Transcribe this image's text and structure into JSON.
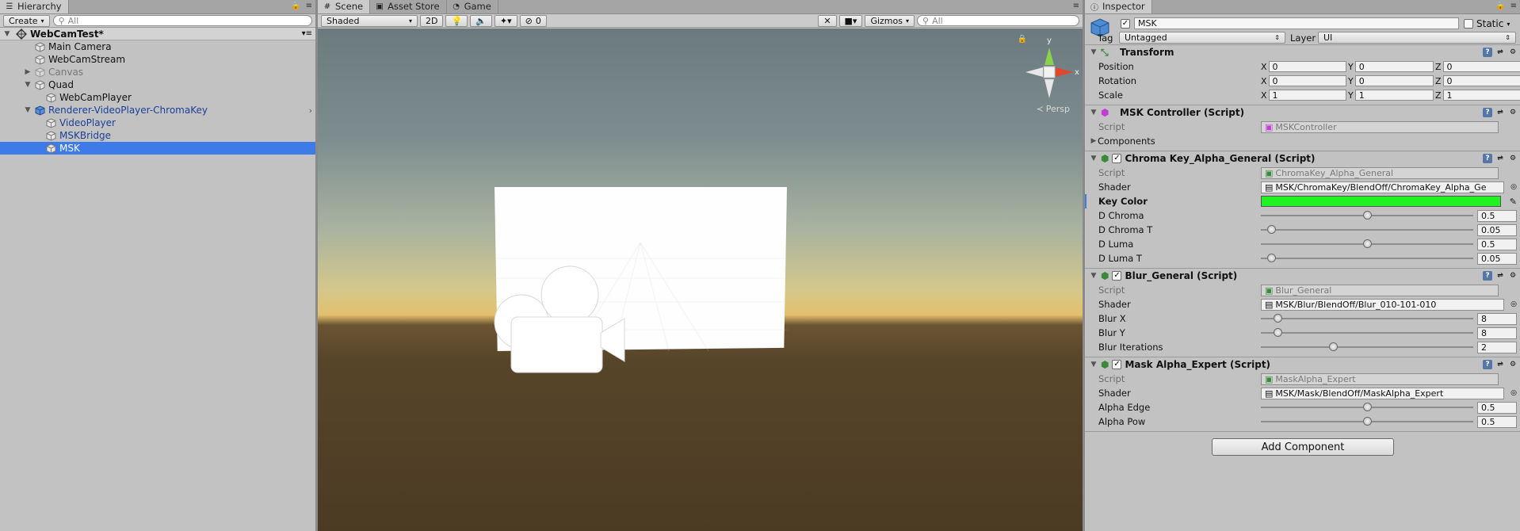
{
  "hierarchy": {
    "tab_label": "Hierarchy",
    "create_label": "Create",
    "search_placeholder": "All",
    "scene_name": "WebCamTest*",
    "items": [
      {
        "label": "Main Camera"
      },
      {
        "label": "WebCamStream"
      },
      {
        "label": "Canvas"
      },
      {
        "label": "Quad"
      },
      {
        "label": "WebCamPlayer"
      },
      {
        "label": "Renderer-VideoPlayer-ChromaKey"
      },
      {
        "label": "VideoPlayer"
      },
      {
        "label": "MSKBridge"
      },
      {
        "label": "MSK"
      }
    ]
  },
  "scene": {
    "tabs": [
      {
        "label": "Scene"
      },
      {
        "label": "Asset Store"
      },
      {
        "label": "Game"
      }
    ],
    "shading_mode": "Shaded",
    "mode_2d": "2D",
    "hidden_count": "0",
    "gizmos_label": "Gizmos",
    "search_placeholder": "All",
    "persp_label": "Persp",
    "gizmo_axes": {
      "x": "x",
      "y": "y"
    }
  },
  "inspector": {
    "tab_label": "Inspector",
    "object_name": "MSK",
    "static_label": "Static",
    "tag_label": "Tag",
    "tag_value": "Untagged",
    "layer_label": "Layer",
    "layer_value": "UI",
    "transform": {
      "title": "Transform",
      "rows": [
        {
          "label": "Position",
          "x": "0",
          "y": "0",
          "z": "0"
        },
        {
          "label": "Rotation",
          "x": "0",
          "y": "0",
          "z": "0"
        },
        {
          "label": "Scale",
          "x": "1",
          "y": "1",
          "z": "1"
        }
      ]
    },
    "msk_controller": {
      "title": "MSK Controller (Script)",
      "script_label": "Script",
      "script_value": "MSKController",
      "components_label": "Components"
    },
    "chroma_key": {
      "title": "Chroma Key_Alpha_General (Script)",
      "script_label": "Script",
      "script_value": "ChromaKey_Alpha_General",
      "shader_label": "Shader",
      "shader_value": "MSK/ChromaKey/BlendOff/ChromaKey_Alpha_Ge",
      "key_color_label": "Key Color",
      "key_color": "#22f222",
      "sliders": [
        {
          "label": "D Chroma",
          "value": "0.5",
          "fraction": 0.5
        },
        {
          "label": "D Chroma T",
          "value": "0.05",
          "fraction": 0.05
        },
        {
          "label": "D Luma",
          "value": "0.5",
          "fraction": 0.5
        },
        {
          "label": "D Luma T",
          "value": "0.05",
          "fraction": 0.05
        }
      ]
    },
    "blur": {
      "title": "Blur_General (Script)",
      "script_label": "Script",
      "script_value": "Blur_General",
      "shader_label": "Shader",
      "shader_value": "MSK/Blur/BlendOff/Blur_010-101-010",
      "sliders": [
        {
          "label": "Blur X",
          "value": "8",
          "fraction": 0.08
        },
        {
          "label": "Blur Y",
          "value": "8",
          "fraction": 0.08
        },
        {
          "label": "Blur Iterations",
          "value": "2",
          "fraction": 0.34
        }
      ]
    },
    "mask_alpha": {
      "title": "Mask Alpha_Expert (Script)",
      "script_label": "Script",
      "script_value": "MaskAlpha_Expert",
      "shader_label": "Shader",
      "shader_value": "MSK/Mask/BlendOff/MaskAlpha_Expert",
      "sliders": [
        {
          "label": "Alpha Edge",
          "value": "0.5",
          "fraction": 0.5
        },
        {
          "label": "Alpha Pow",
          "value": "0.5",
          "fraction": 0.5
        }
      ]
    },
    "add_component_label": "Add Component"
  }
}
